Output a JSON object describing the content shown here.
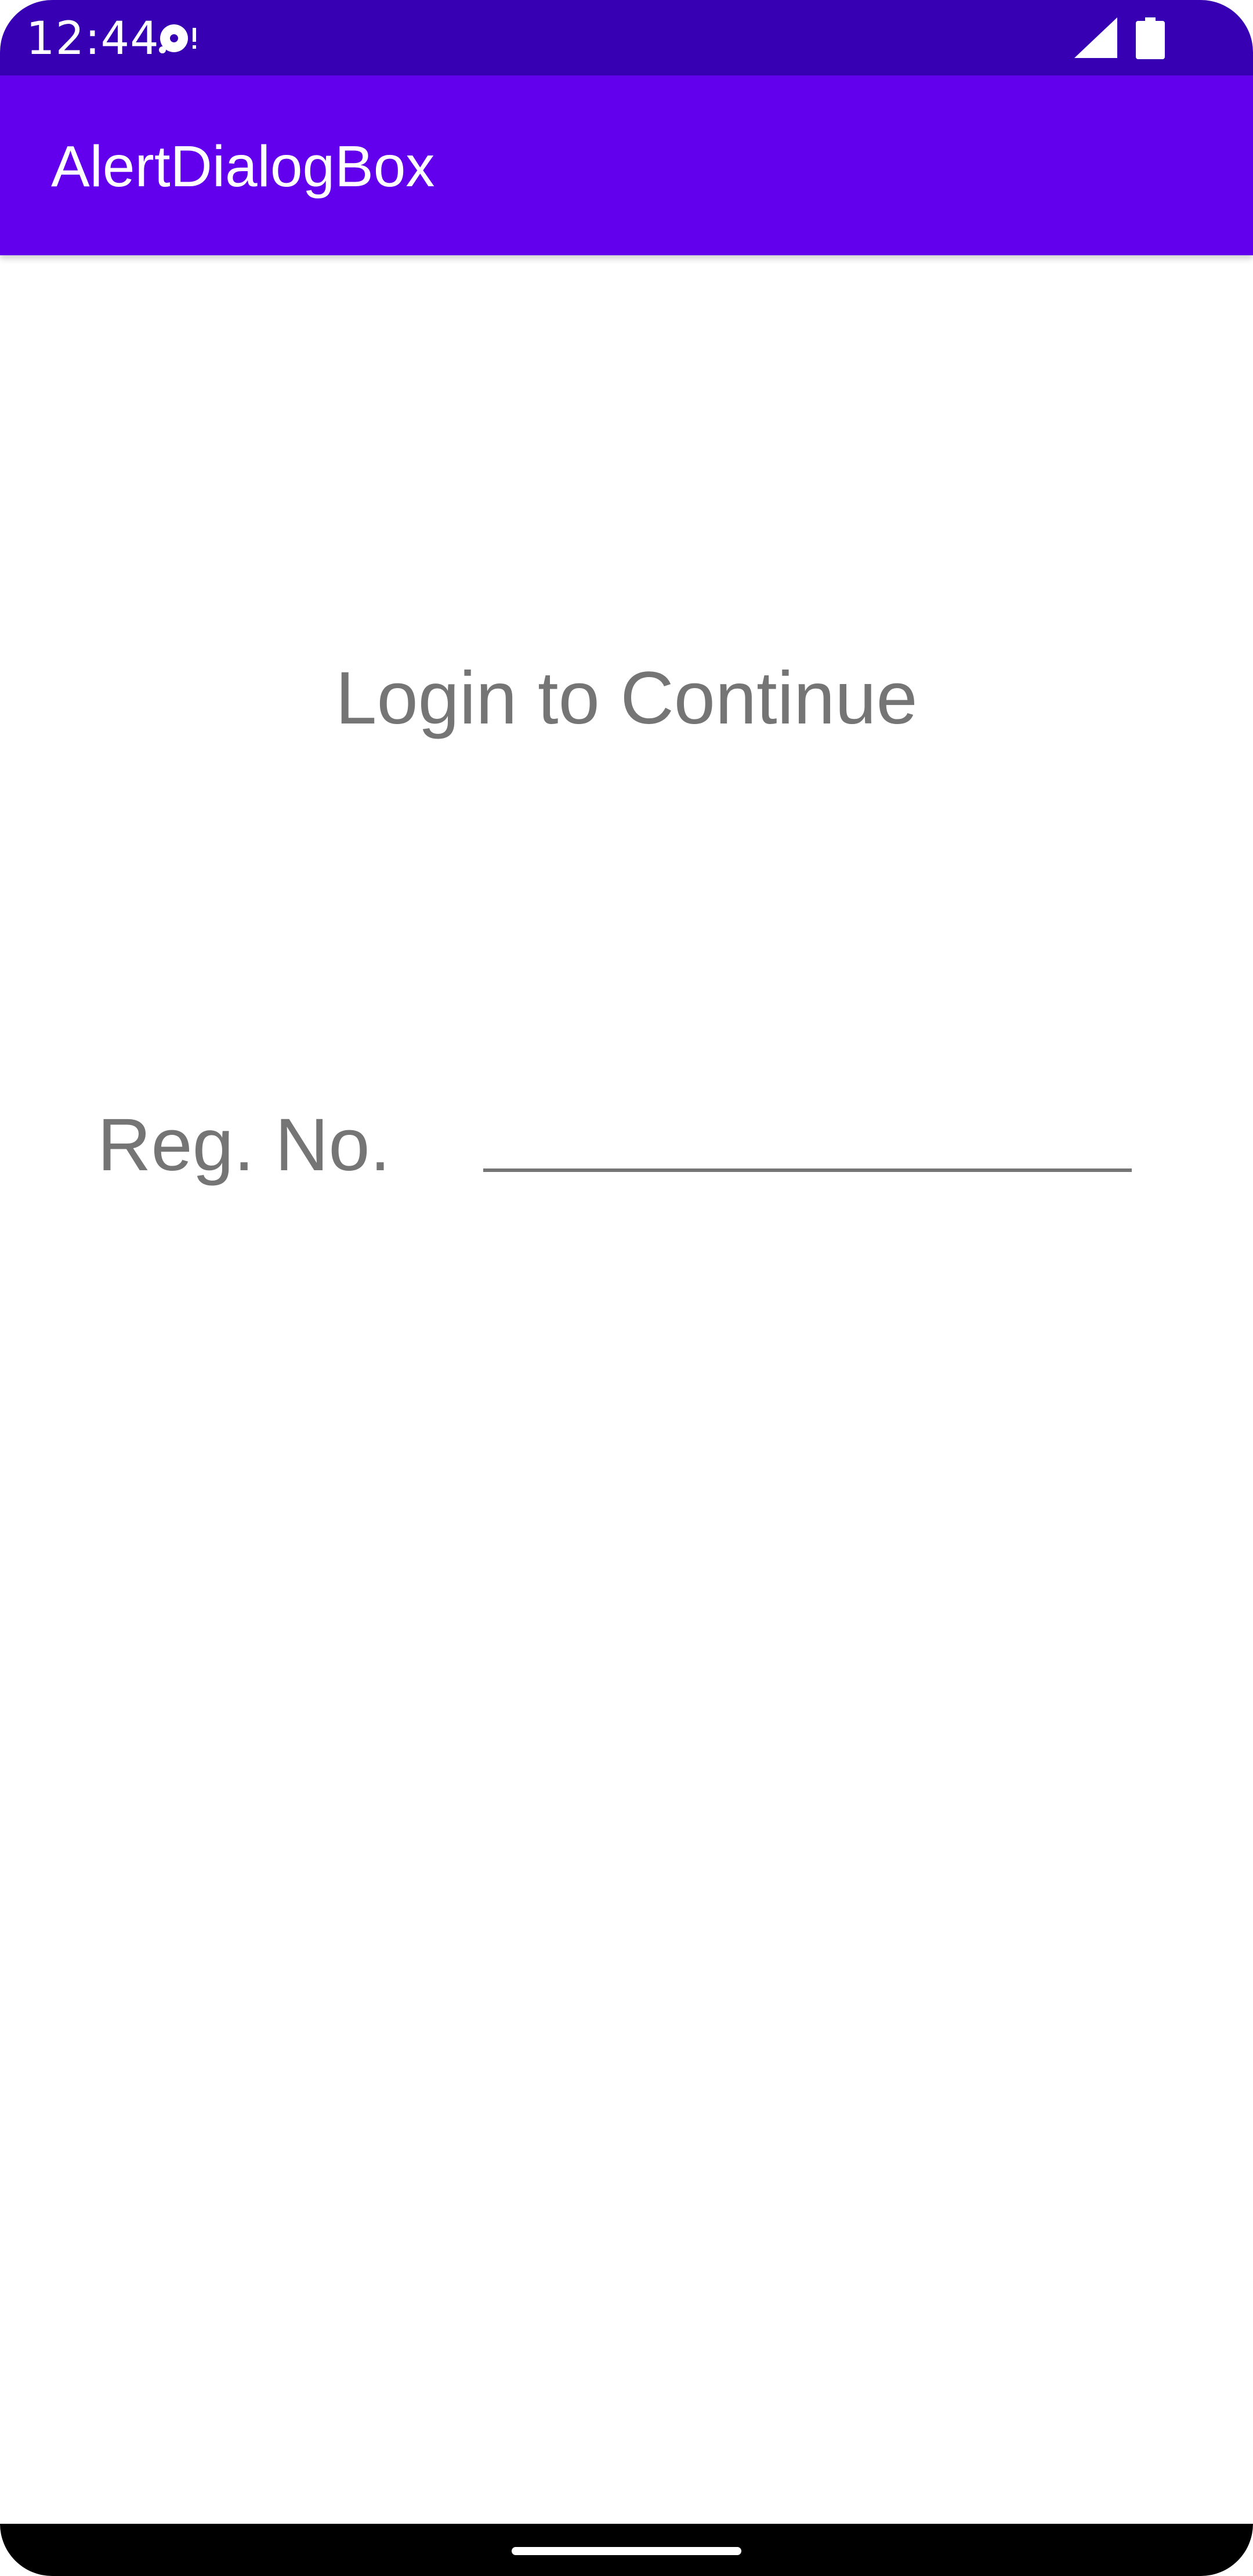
{
  "status_bar": {
    "time": "12:44",
    "notification_icon": "media-disc-icon",
    "signal_icon": "cellular-signal-icon",
    "battery_icon": "battery-icon"
  },
  "app_bar": {
    "title": "AlertDialogBox"
  },
  "main": {
    "heading": "Login to Continue",
    "reg_label": "Reg. No.",
    "reg_input_value": ""
  },
  "colors": {
    "status_bar": "#3700B3",
    "app_bar": "#6200EE",
    "text_gray": "#757575"
  }
}
